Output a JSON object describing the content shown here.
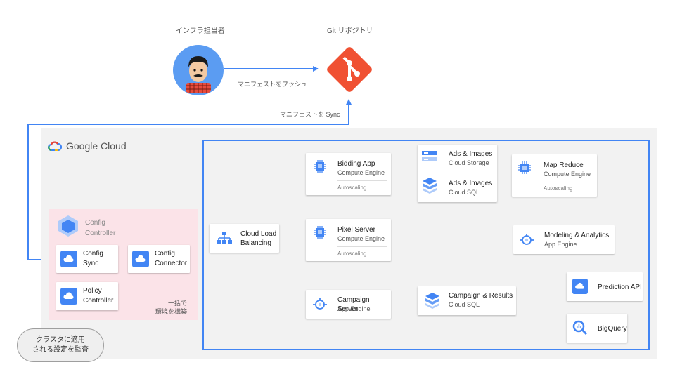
{
  "top": {
    "person_label": "インフラ担当者",
    "git_label": "Git リポジトリ",
    "push_label": "マニフェストをプッシュ",
    "sync_label": "マニフェストを Sync"
  },
  "google_cloud": {
    "brand": "Google Cloud"
  },
  "config_controller": {
    "title_line1": "Config",
    "title_line2": "Controller",
    "sync_line1": "Config",
    "sync_line2": "Sync",
    "connector_line1": "Config",
    "connector_line2": "Connector",
    "policy_line1": "Policy",
    "policy_line2": "Controller",
    "build_line1": "一括で",
    "build_line2": "環境を構築",
    "callout_line1": "クラスタに適用",
    "callout_line2": "される設定を監査"
  },
  "services": {
    "lb_line1": "Cloud Load",
    "lb_line2": "Balancing",
    "bidding_title": "Bidding App",
    "bidding_sub": "Compute Engine",
    "bidding_auto": "Autoscaling",
    "pixel_title": "Pixel Server",
    "pixel_sub": "Compute Engine",
    "pixel_auto": "Autoscaling",
    "campaign_title": "Campaign Server",
    "campaign_sub": "App Engine",
    "ads_storage_title": "Ads & Images",
    "ads_storage_sub": "Cloud Storage",
    "ads_sql_title": "Ads & Images",
    "ads_sql_sub": "Cloud SQL",
    "results_title": "Campaign & Results",
    "results_sub": "Cloud SQL",
    "mapreduce_title": "Map Reduce",
    "mapreduce_sub": "Compute Engine",
    "mapreduce_auto": "Autoscaling",
    "modeling_title": "Modeling & Analytics",
    "modeling_sub": "App Engine",
    "prediction_title": "Prediction API",
    "bigquery_title": "BigQuery"
  },
  "colors": {
    "blue": "#4285f4",
    "git_red": "#f05133",
    "pink": "#fbe3e8"
  }
}
